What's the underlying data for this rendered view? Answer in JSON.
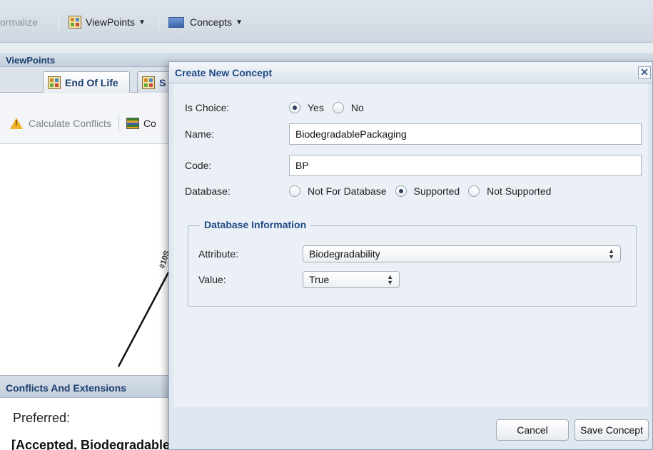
{
  "toolbar": {
    "formalize_label": "ormalize",
    "viewpoints_label": "ViewPoints",
    "concepts_label": "Concepts"
  },
  "viewpoints_panel": {
    "title": "ViewPoints",
    "tabs": [
      {
        "label": "End Of Life"
      },
      {
        "label": "S"
      }
    ],
    "calculate_conflicts_label": "Calculate Conflicts",
    "second_tool_label": "Co"
  },
  "canvas": {
    "edge_label": "#10S"
  },
  "conflicts_panel": {
    "title": "Conflicts And Extensions",
    "preferred_label": "Preferred:",
    "accepted_text": "[Accepted, BiodegradableP̶̶a̶c̶k̶a̶g̶i̶n̶g̶, CompostableP̶a̶c̶k̶a̶g̶i̶n̶g̶, Not RecyclableP̶a̶c̶k̶a̶g̶i̶n̶g̶"
  },
  "dialog": {
    "title": "Create New Concept",
    "close_glyph": "✕",
    "is_choice_label": "Is Choice:",
    "is_choice_options": [
      "Yes",
      "No"
    ],
    "is_choice_selected": "Yes",
    "name_label": "Name:",
    "name_value": "BiodegradablePackaging",
    "code_label": "Code:",
    "code_value": "BP",
    "database_label": "Database:",
    "database_options": [
      "Not For Database",
      "Supported",
      "Not Supported"
    ],
    "database_selected": "Supported",
    "database_info": {
      "legend": "Database Information",
      "attribute_label": "Attribute:",
      "attribute_value": "Biodegradability",
      "value_label": "Value:",
      "value_value": "True"
    },
    "cancel_label": "Cancel",
    "save_label": "Save Concept"
  }
}
